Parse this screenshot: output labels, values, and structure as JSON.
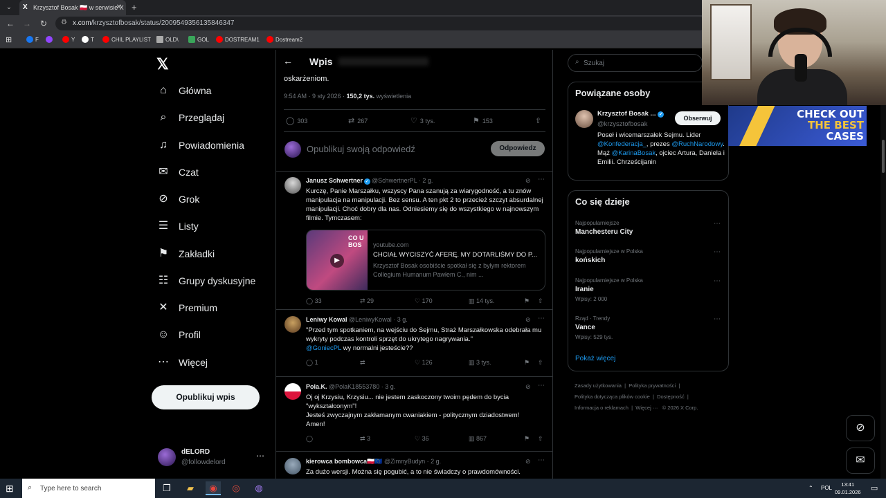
{
  "browser": {
    "tab_title": "Krzysztof Bosak 🇵🇱 w serwisie X",
    "url_domain": "x.com",
    "url_path": "/krzysztofbosak/status/2009549356135846347",
    "bookmarks": [
      {
        "label": "F",
        "color": "#1877f2"
      },
      {
        "label": "",
        "color": "#9146ff"
      },
      {
        "label": "Y",
        "color": "#ff0000"
      },
      {
        "label": "T",
        "color": "#ffffff"
      },
      {
        "label": "CHIL PLAYLIST",
        "color": "#ff0000"
      },
      {
        "label": "OLD\\",
        "color": "#aaaaaa"
      },
      {
        "label": "GOL",
        "color": "#3aa55a"
      },
      {
        "label": "DOSTREAM1",
        "color": "#ff0000"
      },
      {
        "label": "Dostream2",
        "color": "#ff0000"
      }
    ]
  },
  "nav": {
    "items": [
      {
        "label": "Główna",
        "icon": "home-icon",
        "glyph": "⌂"
      },
      {
        "label": "Przeglądaj",
        "icon": "search-icon",
        "glyph": "⌕"
      },
      {
        "label": "Powiadomienia",
        "icon": "bell-icon",
        "glyph": "♫"
      },
      {
        "label": "Czat",
        "icon": "mail-icon",
        "glyph": "✉"
      },
      {
        "label": "Grok",
        "icon": "grok-icon",
        "glyph": "⊘"
      },
      {
        "label": "Listy",
        "icon": "list-icon",
        "glyph": "☰"
      },
      {
        "label": "Zakładki",
        "icon": "bookmark-icon",
        "glyph": "⚑"
      },
      {
        "label": "Grupy dyskusyjne",
        "icon": "communities-icon",
        "glyph": "☷"
      },
      {
        "label": "Premium",
        "icon": "x-icon",
        "glyph": "✕"
      },
      {
        "label": "Profil",
        "icon": "profile-icon",
        "glyph": "☺"
      },
      {
        "label": "Więcej",
        "icon": "more-icon",
        "glyph": "⋯"
      }
    ],
    "post_button": "Opublikuj wpis",
    "account": {
      "name": "dELORD",
      "handle": "@followdelord"
    }
  },
  "main": {
    "header_title": "Wpis",
    "tail_text": "oskarżeniom.",
    "meta": {
      "time": "9:54 AM · 9 sty 2026 · ",
      "views_count": "150,2 tys.",
      "views_label": " wyświetlenia"
    },
    "stats": {
      "replies": "303",
      "reposts": "267",
      "likes": "3 tys.",
      "bookmarks": "153"
    },
    "reply_placeholder": "Opublikuj swoją odpowiedź",
    "reply_button": "Odpowiedz",
    "replies": [
      {
        "name": "Janusz Schwertner",
        "handle": "@SchwertnerPL · 2 g.",
        "text": "Kurczę, Panie Marszałku, wszyscy Pana szanują za wiarygodność, a tu znów manipulacja na manipulacji. Bez sensu. A ten pkt 2 to przecież szczyt absurdalnej manipulacji. Choć dobry dla nas. Odniesiemy się do wszystkiego w najnowszym filmie. Tymczasem:",
        "card": {
          "domain": "youtube.com",
          "title": "CHCIAŁ WYCISZYĆ AFERĘ. MY DOTARLIŚMY DO P...",
          "desc": "Krzysztof Bosak osobiście spotkał się z byłym rektorem Collegium Humanum Pawłem C., nim ...",
          "thumb_text": "CO U BOS"
        },
        "stats": {
          "replies": "33",
          "reposts": "29",
          "likes": "170",
          "views": "14 tys."
        }
      },
      {
        "name": "Leniwy Kowal",
        "handle": "@LeniwyKowal · 3 g.",
        "text": "\"Przed tym spotkaniem, na wejściu do Sejmu, Straż Marszałkowska odebrała mu wykryty podczas kontroli sprzęt do ukrytego nagrywania.\"",
        "mention": "@GoniecPL",
        "text_after": " wy normalni jesteście??",
        "stats": {
          "replies": "1",
          "reposts": "",
          "likes": "126",
          "views": "3 tys."
        }
      },
      {
        "name": "Pola.K.",
        "handle": "@PolaK18553780 · 3 g.",
        "text_lines": [
          "Oj oj Krzysiu, Krzysiu... nie jestem zaskoczony twoim pędem do bycia \"wykształconym\"!",
          "Jesteś zwyczajnym zakłamanym cwaniakiem - politycznym dziadostwem!",
          "Amen!"
        ],
        "stats": {
          "replies": "",
          "reposts": "3",
          "likes": "36",
          "views": "867"
        }
      },
      {
        "name": "kierowca bombowca🇵🇱🇪🇺",
        "handle": "@ZimnyBudyn · 2 g.",
        "text": "Za dużo wersji. Można się pogubić, a to nie świadczy o prawdomówności."
      }
    ]
  },
  "right": {
    "search_placeholder": "Szukaj",
    "related": {
      "title": "Powiązane osoby",
      "name": "Krzysztof Bosak ...",
      "handle": "@krzysztofbosak",
      "follow": "Obserwuj",
      "bio_1": "Poseł i wicemarszałek Sejmu. Lider ",
      "bio_link_1": "@Konfederacja_",
      "bio_2": ", prezes ",
      "bio_link_2": "@RuchNarodowy",
      "bio_3": ". Mąż ",
      "bio_link_3": "@KarinaBosak",
      "bio_4": ", ojciec Artura, Daniela i Emilii. Chrześcijanin"
    },
    "trends": {
      "title": "Co się dzieje",
      "items": [
        {
          "context": "Najpopularniejsze",
          "title": "Manchesteru City",
          "posts": ""
        },
        {
          "context": "Najpopularniejsze w Polska",
          "title": "końskich",
          "posts": ""
        },
        {
          "context": "Najpopularniejsze w Polska",
          "title": "Iranie",
          "posts": "Wpisy: 2 000"
        },
        {
          "context": "Rząd · Trendy",
          "title": "Vance",
          "posts": "Wpisy: 529 tys."
        }
      ],
      "show_more": "Pokaż więcej"
    },
    "footer": [
      "Zasady użytkowania",
      "Polityka prywatności",
      "Polityka dotycząca plików cookie",
      "Dostępność",
      "Informacja o reklamach",
      "Więcej ···",
      "© 2026 X Corp."
    ]
  },
  "promo": {
    "line1": "CHECK OUT",
    "line2": "THE BEST",
    "line3": "CASES"
  },
  "taskbar": {
    "search_placeholder": "Type here to search",
    "lang": "POL",
    "time": "13:41",
    "date": "09.01.2026"
  }
}
